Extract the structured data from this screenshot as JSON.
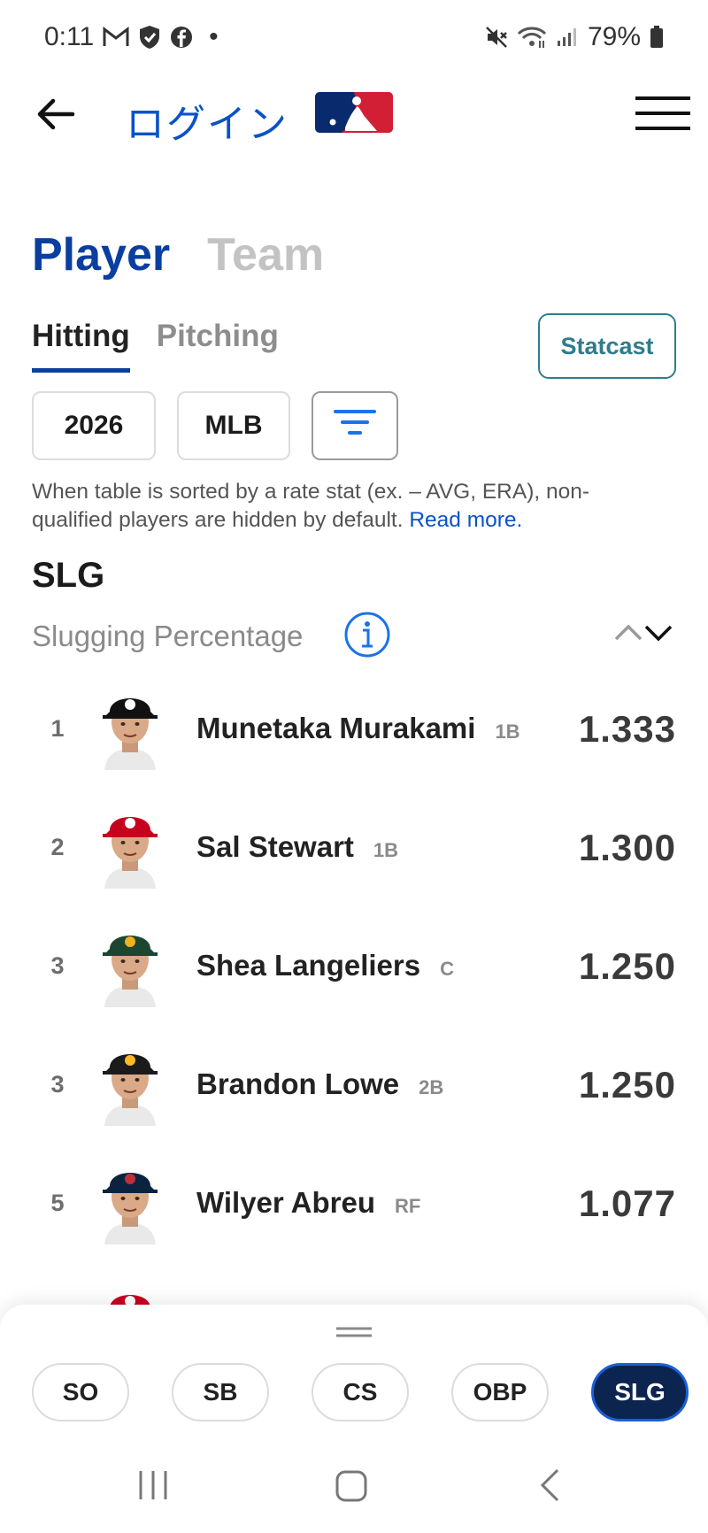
{
  "status_bar": {
    "time": "0:11",
    "dot": "•",
    "battery": "79%",
    "icons": [
      "gmail-icon",
      "shield-icon",
      "facebook-icon",
      "mute-icon",
      "wifi-icon",
      "signal-icon",
      "battery-icon"
    ]
  },
  "header": {
    "login": "ログイン",
    "logo": "mlb-logo",
    "menu": "menu-icon"
  },
  "big_tabs": [
    {
      "label": "Player",
      "active": true
    },
    {
      "label": "Team",
      "active": false
    }
  ],
  "sub_tabs": [
    {
      "label": "Hitting",
      "active": true
    },
    {
      "label": "Pitching",
      "active": false
    }
  ],
  "statcast_label": "Statcast",
  "filters": {
    "season": "2026",
    "league": "MLB",
    "sort_icon": "filter-icon"
  },
  "note": {
    "text": "When table is sorted by a rate stat (ex. – AVG, ERA), non-qualified players are hidden by default. ",
    "link": "Read more."
  },
  "stat": {
    "abbr": "SLG",
    "full": "Slugging Percentage"
  },
  "players": [
    {
      "rank": "1",
      "name": "Munetaka Murakami",
      "pos": "1B",
      "value": "1.333",
      "team": "white-sox",
      "cap": "#111111",
      "logo_color": "#ffffff"
    },
    {
      "rank": "2",
      "name": "Sal Stewart",
      "pos": "1B",
      "value": "1.300",
      "team": "reds",
      "cap": "#c6011f",
      "logo_color": "#ffffff"
    },
    {
      "rank": "3",
      "name": "Shea Langeliers",
      "pos": "C",
      "value": "1.250",
      "team": "athletics",
      "cap": "#1c4532",
      "logo_color": "#efb21e"
    },
    {
      "rank": "3",
      "name": "Brandon Lowe",
      "pos": "2B",
      "value": "1.250",
      "team": "pirates",
      "cap": "#1b1b1b",
      "logo_color": "#fdb827"
    },
    {
      "rank": "5",
      "name": "Wilyer Abreu",
      "pos": "RF",
      "value": "1.077",
      "team": "red-sox",
      "cap": "#0c2340",
      "logo_color": "#bd3039"
    }
  ],
  "partial_player": {
    "cap": "#c6011f"
  },
  "chips": [
    {
      "label": "SO",
      "selected": false
    },
    {
      "label": "SB",
      "selected": false
    },
    {
      "label": "CS",
      "selected": false
    },
    {
      "label": "OBP",
      "selected": false
    },
    {
      "label": "SLG",
      "selected": true
    }
  ],
  "colors": {
    "primary": "#0a3ea0",
    "link": "#0a52c7",
    "statcast": "#2e7d8c",
    "chip_selected": "#0b2450"
  }
}
